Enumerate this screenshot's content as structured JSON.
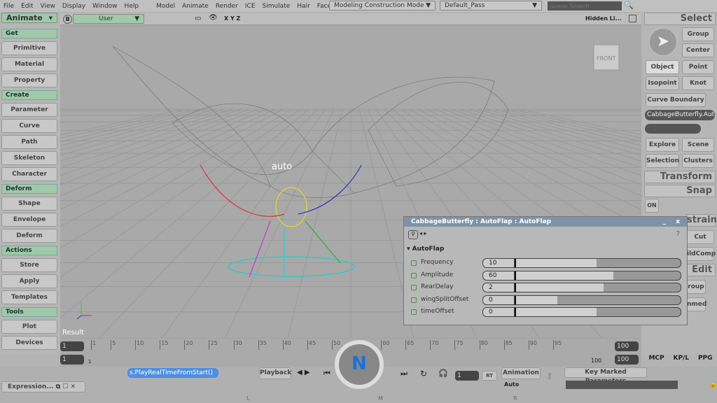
{
  "menu": [
    "File",
    "Edit",
    "View",
    "Display",
    "Window",
    "Help",
    "Model",
    "Animate",
    "Render",
    "ICE",
    "Simulate",
    "Hair",
    "Face Robot"
  ],
  "mode_dropdown": "Modeling Construction Mode",
  "pass_dropdown": "Default_Pass",
  "scene_search_placeholder": "Scene Search",
  "toolbar_mode": "Animate",
  "viewport": {
    "camera": "User",
    "axes": "X Y Z",
    "display_mode": "Hidden Li...",
    "cube_label": "FRONT",
    "result_label": "Result",
    "object_label": "auto"
  },
  "left_panel": {
    "sections": [
      {
        "title": "Get",
        "items": [
          "Primitive",
          "Material",
          "Property"
        ]
      },
      {
        "title": "Create",
        "items": [
          "Parameter",
          "Curve",
          "Path",
          "Skeleton",
          "Character"
        ]
      },
      {
        "title": "Deform",
        "items": [
          "Shape",
          "Envelope",
          "Deform"
        ]
      },
      {
        "title": "Actions",
        "items": [
          "Store",
          "Apply",
          "Templates"
        ]
      },
      {
        "title": "Tools",
        "items": [
          "Plot",
          "Devices"
        ]
      }
    ]
  },
  "right_panel": {
    "select": "Select",
    "group": "Group",
    "center": "Center",
    "object": "Object",
    "point": "Point",
    "isopoint": "Isopoint",
    "knot": "Knot",
    "curve_boundary": "Curve Boundary",
    "selection_field": "CabbageButterfly.Auto",
    "explore": "Explore",
    "scene": "Scene",
    "selection": "Selection",
    "clusters": "Clusters",
    "transform": "Transform",
    "snap": "Snap",
    "snap_on": "ON",
    "constrain": "strain",
    "cut": "Cut",
    "childcomp": "ildComp",
    "edit": "Edit",
    "group2": "roup",
    "immed": "nmed"
  },
  "ppg": {
    "title": "CabbageButterfly : AutoFlap : AutoFlap",
    "close": "x",
    "minimize": "_",
    "section": "AutoFlap",
    "params": [
      {
        "label": "Frequency",
        "value": "10",
        "fill": 0.49
      },
      {
        "label": "Amplitude",
        "value": "60",
        "fill": 0.59
      },
      {
        "label": "RearDelay",
        "value": "2",
        "fill": 0.53
      },
      {
        "label": "wingSplitOffset",
        "value": "0",
        "fill": 0.25
      },
      {
        "label": "timeOffset",
        "value": "0",
        "fill": 0.49
      }
    ]
  },
  "timeline": {
    "start": "1",
    "start2": "1",
    "current_marker": "1",
    "end": "100",
    "end2": "100",
    "end_label": "100",
    "ticks": [
      "1",
      "5",
      "10",
      "15",
      "20",
      "25",
      "30",
      "35",
      "40",
      "45",
      "50",
      "55",
      "60",
      "65",
      "70",
      "75",
      "80",
      "85",
      "90",
      "95"
    ]
  },
  "playback": {
    "command": "s.PlayRealTimeFromStart()",
    "playback_label": "Playback",
    "frame": "1",
    "rt": "RT",
    "animation": "Animation",
    "auto": "Auto",
    "key_marked": "Key Marked Parameters"
  },
  "tabs": [
    "MCP",
    "KP/L",
    "PPG"
  ],
  "mouse_labels": [
    "L",
    "M",
    "R"
  ],
  "expression_tab": "Expression...",
  "colors": {
    "section_green": "#9fc9a9",
    "title_blue": "#7f93a8",
    "selection_blue": "#4d8fe0"
  }
}
